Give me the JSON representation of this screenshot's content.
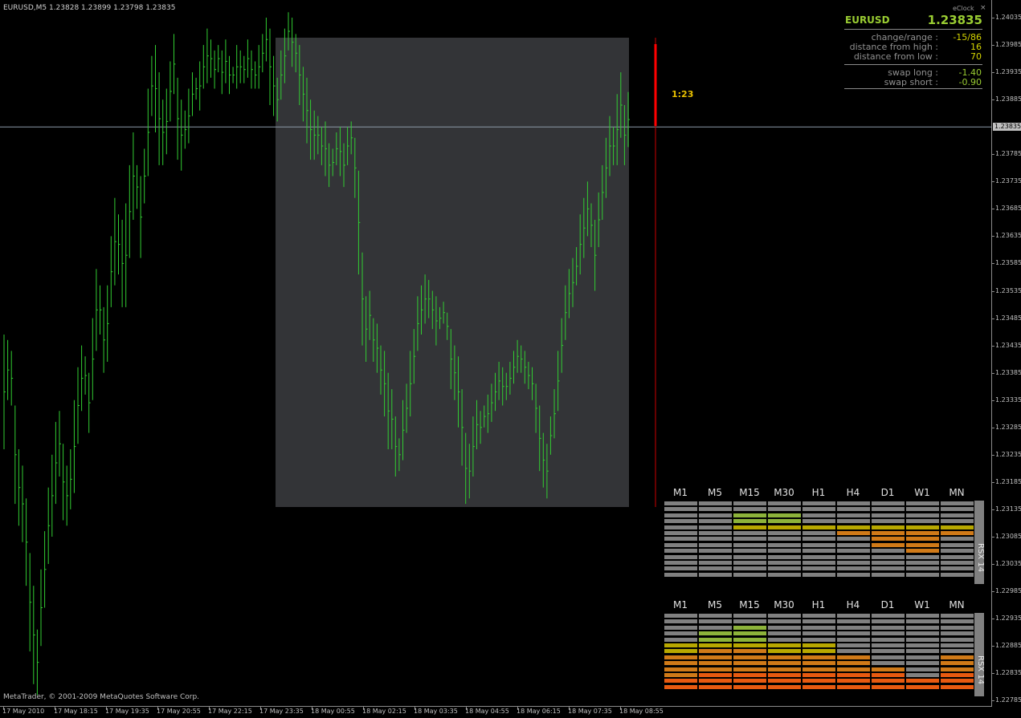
{
  "window": {
    "title": "EURUSD,M5  1.23828 1.23899 1.23798 1.23835",
    "copyright": "MetaTrader, © 2001-2009 MetaQuotes Software Corp."
  },
  "chart_data": {
    "type": "bar",
    "symbol": "EURUSD",
    "timeframe": "M5",
    "ylim": [
      1.22755,
      1.24055
    ],
    "y_ticks": [
      "1.24035",
      "1.23985",
      "1.23935",
      "1.23885",
      "1.23785",
      "1.23735",
      "1.23685",
      "1.23635",
      "1.23585",
      "1.23535",
      "1.23485",
      "1.23435",
      "1.23385",
      "1.23335",
      "1.23285",
      "1.23235",
      "1.23185",
      "1.23135",
      "1.23085",
      "1.23035",
      "1.22985",
      "1.22935",
      "1.22885",
      "1.22835",
      "1.22785"
    ],
    "x_ticks": [
      "17 May 2010",
      "17 May 18:15",
      "17 May 19:35",
      "17 May 20:55",
      "17 May 22:15",
      "17 May 23:35",
      "18 May 00:55",
      "18 May 02:15",
      "18 May 03:35",
      "18 May 04:55",
      "18 May 06:15",
      "18 May 07:35",
      "18 May 08:55"
    ],
    "current_price": "1.23835",
    "current_price_value": 1.23835,
    "bar_color": "#32cd32",
    "series": [
      {
        "values": [
          [
            1.23455,
            1.23245
          ],
          [
            1.23445,
            1.23335
          ],
          [
            1.23425,
            1.23325
          ],
          [
            1.23325,
            1.23145
          ],
          [
            1.23245,
            1.23105
          ],
          [
            1.23215,
            1.23075
          ],
          [
            1.23155,
            1.22995
          ],
          [
            1.23055,
            1.22875
          ],
          [
            1.22995,
            1.22815
          ],
          [
            1.22915,
            1.22795
          ],
          [
            1.23025,
            1.22885
          ],
          [
            1.23095,
            1.22955
          ],
          [
            1.23175,
            1.23035
          ],
          [
            1.23235,
            1.23085
          ],
          [
            1.23295,
            1.23145
          ],
          [
            1.23315,
            1.23195
          ],
          [
            1.23255,
            1.23115
          ],
          [
            1.23215,
            1.23105
          ],
          [
            1.23245,
            1.23135
          ],
          [
            1.23335,
            1.23165
          ],
          [
            1.23395,
            1.23255
          ],
          [
            1.23435,
            1.23315
          ],
          [
            1.23415,
            1.23345
          ],
          [
            1.23385,
            1.23275
          ],
          [
            1.23485,
            1.23335
          ],
          [
            1.23575,
            1.23425
          ],
          [
            1.23545,
            1.23455
          ],
          [
            1.23505,
            1.23385
          ],
          [
            1.23545,
            1.23405
          ],
          [
            1.23635,
            1.23505
          ],
          [
            1.23705,
            1.23545
          ],
          [
            1.23675,
            1.23565
          ],
          [
            1.23665,
            1.23505
          ],
          [
            1.23695,
            1.23505
          ],
          [
            1.23765,
            1.23595
          ],
          [
            1.23825,
            1.23665
          ],
          [
            1.23765,
            1.23685
          ],
          [
            1.23745,
            1.23595
          ],
          [
            1.23795,
            1.23695
          ],
          [
            1.23905,
            1.23745
          ],
          [
            1.23965,
            1.23855
          ],
          [
            1.23985,
            1.23825
          ],
          [
            1.23935,
            1.23765
          ],
          [
            1.23885,
            1.23765
          ],
          [
            1.23905,
            1.23785
          ],
          [
            1.23955,
            1.23845
          ],
          [
            1.24005,
            1.23895
          ],
          [
            1.23925,
            1.23775
          ],
          [
            1.23885,
            1.23755
          ],
          [
            1.23865,
            1.23795
          ],
          [
            1.23905,
            1.23805
          ],
          [
            1.23935,
            1.23855
          ],
          [
            1.23925,
            1.23885
          ],
          [
            1.23955,
            1.23865
          ],
          [
            1.23985,
            1.23905
          ],
          [
            1.24015,
            1.23915
          ],
          [
            1.23995,
            1.23925
          ],
          [
            1.23975,
            1.23905
          ],
          [
            1.23985,
            1.23935
          ],
          [
            1.23975,
            1.23895
          ],
          [
            1.23995,
            1.23915
          ],
          [
            1.23965,
            1.23895
          ],
          [
            1.23945,
            1.23915
          ],
          [
            1.23985,
            1.23905
          ],
          [
            1.23975,
            1.23915
          ],
          [
            1.23965,
            1.23915
          ],
          [
            1.23995,
            1.23925
          ],
          [
            1.23975,
            1.23905
          ],
          [
            1.23955,
            1.23905
          ],
          [
            1.23985,
            1.23905
          ],
          [
            1.24005,
            1.23935
          ],
          [
            1.24035,
            1.23955
          ],
          [
            1.24015,
            1.23875
          ],
          [
            1.23965,
            1.23855
          ],
          [
            1.23925,
            1.23845
          ],
          [
            1.23975,
            1.23885
          ],
          [
            1.24015,
            1.23915
          ],
          [
            1.24045,
            1.23975
          ],
          [
            1.24035,
            1.23945
          ],
          [
            1.24005,
            1.23935
          ],
          [
            1.23985,
            1.23875
          ],
          [
            1.23945,
            1.23845
          ],
          [
            1.23925,
            1.23805
          ],
          [
            1.23885,
            1.23775
          ],
          [
            1.23865,
            1.23775
          ],
          [
            1.23855,
            1.23785
          ],
          [
            1.23835,
            1.23765
          ],
          [
            1.23845,
            1.23745
          ],
          [
            1.23805,
            1.23725
          ],
          [
            1.23795,
            1.23745
          ],
          [
            1.23825,
            1.23765
          ],
          [
            1.23835,
            1.23745
          ],
          [
            1.23805,
            1.23725
          ],
          [
            1.23835,
            1.23765
          ],
          [
            1.23845,
            1.23785
          ],
          [
            1.23815,
            1.23705
          ],
          [
            1.23755,
            1.23565
          ],
          [
            1.23605,
            1.23435
          ],
          [
            1.23525,
            1.23405
          ],
          [
            1.23535,
            1.23445
          ],
          [
            1.23485,
            1.23405
          ],
          [
            1.23475,
            1.23385
          ],
          [
            1.23435,
            1.23345
          ],
          [
            1.23425,
            1.23305
          ],
          [
            1.23385,
            1.23245
          ],
          [
            1.23355,
            1.23245
          ],
          [
            1.23305,
            1.23195
          ],
          [
            1.23265,
            1.23205
          ],
          [
            1.23335,
            1.23225
          ],
          [
            1.23365,
            1.23275
          ],
          [
            1.23425,
            1.23305
          ],
          [
            1.23465,
            1.23365
          ],
          [
            1.23525,
            1.23425
          ],
          [
            1.23545,
            1.23455
          ],
          [
            1.23565,
            1.23475
          ],
          [
            1.23555,
            1.23485
          ],
          [
            1.23535,
            1.23465
          ],
          [
            1.23525,
            1.23435
          ],
          [
            1.23505,
            1.23465
          ],
          [
            1.23515,
            1.23475
          ],
          [
            1.23495,
            1.23445
          ],
          [
            1.23465,
            1.23355
          ],
          [
            1.23435,
            1.23335
          ],
          [
            1.23415,
            1.23285
          ],
          [
            1.23355,
            1.23215
          ],
          [
            1.23275,
            1.23145
          ],
          [
            1.23255,
            1.23155
          ],
          [
            1.23305,
            1.23195
          ],
          [
            1.23335,
            1.23245
          ],
          [
            1.23315,
            1.23255
          ],
          [
            1.23325,
            1.23285
          ],
          [
            1.23345,
            1.23275
          ],
          [
            1.23365,
            1.23295
          ],
          [
            1.23385,
            1.23315
          ],
          [
            1.23405,
            1.23335
          ],
          [
            1.23395,
            1.23325
          ],
          [
            1.23385,
            1.23335
          ],
          [
            1.23405,
            1.23345
          ],
          [
            1.23425,
            1.23365
          ],
          [
            1.23445,
            1.23385
          ],
          [
            1.23435,
            1.23385
          ],
          [
            1.23425,
            1.23365
          ],
          [
            1.23405,
            1.23355
          ],
          [
            1.23395,
            1.23335
          ],
          [
            1.23365,
            1.23275
          ],
          [
            1.23325,
            1.23205
          ],
          [
            1.23275,
            1.23175
          ],
          [
            1.23255,
            1.23155
          ],
          [
            1.23305,
            1.23235
          ],
          [
            1.23355,
            1.23265
          ],
          [
            1.23425,
            1.23315
          ],
          [
            1.23485,
            1.23385
          ],
          [
            1.23545,
            1.23445
          ],
          [
            1.23575,
            1.23485
          ],
          [
            1.23595,
            1.23505
          ],
          [
            1.23615,
            1.23545
          ],
          [
            1.23675,
            1.23565
          ],
          [
            1.23705,
            1.23595
          ],
          [
            1.23735,
            1.23635
          ],
          [
            1.23695,
            1.23615
          ],
          [
            1.23665,
            1.23535
          ],
          [
            1.23715,
            1.23615
          ],
          [
            1.23765,
            1.23665
          ],
          [
            1.23815,
            1.23705
          ],
          [
            1.23855,
            1.23745
          ],
          [
            1.23835,
            1.23765
          ],
          [
            1.23895,
            1.23765
          ],
          [
            1.23935,
            1.23815
          ],
          [
            1.23875,
            1.23765
          ],
          [
            1.23899,
            1.23798
          ]
        ]
      }
    ]
  },
  "overlay": {
    "timer": "1:23"
  },
  "eclock": {
    "title": "eClock",
    "close": "×",
    "symbol": "EURUSD",
    "price": "1.23835",
    "rows": [
      {
        "label": "change/range :",
        "value": "-15/86"
      },
      {
        "label": "distance from high :",
        "value": "16"
      },
      {
        "label": "distance from low :",
        "value": "70"
      }
    ],
    "swaps": [
      {
        "label": "swap long :",
        "value": "-1.40"
      },
      {
        "label": "swap short :",
        "value": "-0.90"
      }
    ]
  },
  "rsx_panels": [
    {
      "timeframes": [
        "M1",
        "M5",
        "M15",
        "M30",
        "H1",
        "H4",
        "D1",
        "W1",
        "MN"
      ],
      "label": "RSX 14",
      "colors": {
        "empty": "#808080",
        "yellow": "#b8a800",
        "green": "#8db33a",
        "orange": "#d07a18",
        "red": "#e85a10"
      },
      "cells": [
        [
          "empty",
          "empty",
          "empty",
          "empty",
          "empty",
          "empty",
          "empty",
          "empty",
          "empty",
          "empty",
          "empty",
          "empty",
          "empty"
        ],
        [
          "empty",
          "empty",
          "empty",
          "empty",
          "empty",
          "empty",
          "empty",
          "empty",
          "empty",
          "empty",
          "empty",
          "empty",
          "empty"
        ],
        [
          "empty",
          "empty",
          "green",
          "green",
          "yellow",
          "empty",
          "empty",
          "empty",
          "empty",
          "empty",
          "empty",
          "empty",
          "empty"
        ],
        [
          "empty",
          "empty",
          "green",
          "green",
          "yellow",
          "empty",
          "empty",
          "empty",
          "empty",
          "empty",
          "empty",
          "empty",
          "empty"
        ],
        [
          "empty",
          "empty",
          "empty",
          "empty",
          "yellow",
          "empty",
          "empty",
          "empty",
          "empty",
          "empty",
          "empty",
          "empty",
          "empty"
        ],
        [
          "empty",
          "empty",
          "empty",
          "empty",
          "yellow",
          "orange",
          "empty",
          "empty",
          "empty",
          "empty",
          "empty",
          "empty",
          "empty"
        ],
        [
          "empty",
          "empty",
          "empty",
          "empty",
          "yellow",
          "orange",
          "orange",
          "orange",
          "empty",
          "empty",
          "empty",
          "empty",
          "empty"
        ],
        [
          "empty",
          "empty",
          "empty",
          "empty",
          "yellow",
          "orange",
          "orange",
          "orange",
          "orange",
          "empty",
          "empty",
          "empty",
          "empty"
        ],
        [
          "empty",
          "empty",
          "empty",
          "empty",
          "yellow",
          "orange",
          "empty",
          "empty",
          "empty",
          "empty",
          "empty",
          "empty",
          "empty"
        ]
      ]
    },
    {
      "timeframes": [
        "M1",
        "M5",
        "M15",
        "M30",
        "H1",
        "H4",
        "D1",
        "W1",
        "MN"
      ],
      "label": "RSX 14",
      "colors": {
        "empty": "#808080",
        "yellow": "#b8a800",
        "green": "#8db33a",
        "orange": "#d07a18",
        "red": "#e85a10"
      },
      "cells": [
        [
          "empty",
          "empty",
          "empty",
          "empty",
          "empty",
          "yellow",
          "yellow",
          "orange",
          "orange",
          "orange",
          "orange",
          "red",
          "red"
        ],
        [
          "empty",
          "empty",
          "empty",
          "green",
          "green",
          "yellow",
          "orange",
          "orange",
          "orange",
          "orange",
          "red",
          "red",
          "red"
        ],
        [
          "empty",
          "empty",
          "green",
          "green",
          "green",
          "yellow",
          "orange",
          "orange",
          "orange",
          "orange",
          "red",
          "red",
          "red"
        ],
        [
          "empty",
          "empty",
          "empty",
          "empty",
          "empty",
          "yellow",
          "yellow",
          "orange",
          "orange",
          "orange",
          "red",
          "red",
          "red"
        ],
        [
          "empty",
          "empty",
          "empty",
          "empty",
          "empty",
          "yellow",
          "yellow",
          "orange",
          "orange",
          "orange",
          "red",
          "red",
          "red"
        ],
        [
          "empty",
          "empty",
          "empty",
          "empty",
          "empty",
          "empty",
          "empty",
          "orange",
          "orange",
          "orange",
          "red",
          "red",
          "red"
        ],
        [
          "empty",
          "empty",
          "empty",
          "empty",
          "empty",
          "empty",
          "empty",
          "empty",
          "empty",
          "orange",
          "red",
          "red",
          "red"
        ],
        [
          "empty",
          "empty",
          "empty",
          "empty",
          "empty",
          "empty",
          "empty",
          "empty",
          "empty",
          "empty",
          "empty",
          "red",
          "red"
        ],
        [
          "empty",
          "empty",
          "empty",
          "empty",
          "empty",
          "empty",
          "empty",
          "orange",
          "orange",
          "orange",
          "red",
          "red",
          "red"
        ]
      ]
    }
  ]
}
